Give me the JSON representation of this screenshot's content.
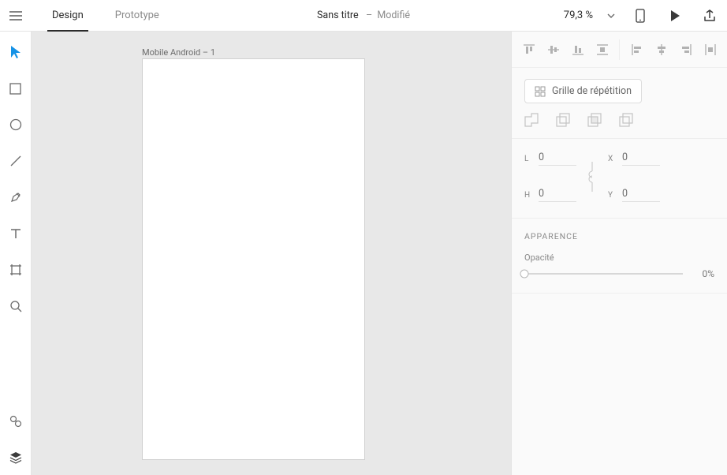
{
  "header": {
    "tabs": {
      "design": "Design",
      "prototype": "Prototype"
    },
    "title": "Sans titre",
    "separator": "–",
    "modified": "Modifié",
    "zoom": "79,3 %"
  },
  "canvas": {
    "artboard_label": "Mobile Android – 1"
  },
  "inspector": {
    "repeat_grid": "Grille de répétition",
    "dims": {
      "L": "L",
      "H": "H",
      "X": "X",
      "Y": "Y",
      "lval": "0",
      "hval": "0",
      "xval": "0",
      "yval": "0"
    },
    "appearance_title": "APPARENCE",
    "opacity_label": "Opacité",
    "opacity_value": "0%"
  }
}
